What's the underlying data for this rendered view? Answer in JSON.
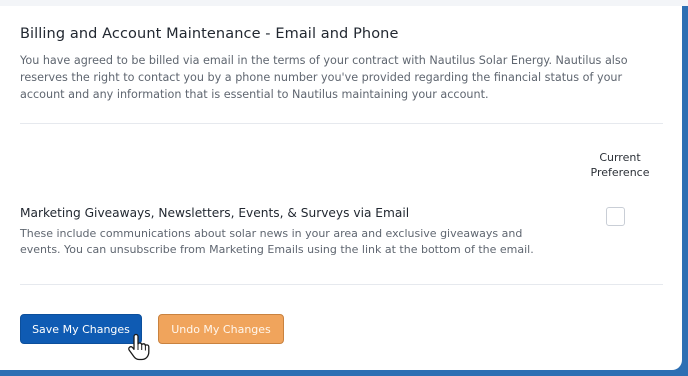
{
  "billing": {
    "title": "Billing and Account Maintenance - Email and Phone",
    "description": "You have agreed to be billed via email in the terms of your contract with Nautilus Solar Energy. Nautilus also reserves the right to contact you by a phone number you've provided regarding the financial status of your account and any information that is essential to Nautilus maintaining your account."
  },
  "preference_header": {
    "line1": "Current",
    "line2": "Preference"
  },
  "marketing": {
    "title": "Marketing Giveaways, Newsletters, Events, & Surveys via Email",
    "description": "These include communications about solar news in your area and exclusive giveaways and events. You can unsubscribe from Marketing Emails using the link at the bottom of the email.",
    "checked": false
  },
  "actions": {
    "save_label": "Save My Changes",
    "undo_label": "Undo My Changes"
  },
  "colors": {
    "save_button": "#0f5bb3",
    "undo_button": "#f0a45c",
    "frame_accent": "#2d6fb3"
  },
  "icons": {
    "cursor": "hand-pointer-icon"
  }
}
